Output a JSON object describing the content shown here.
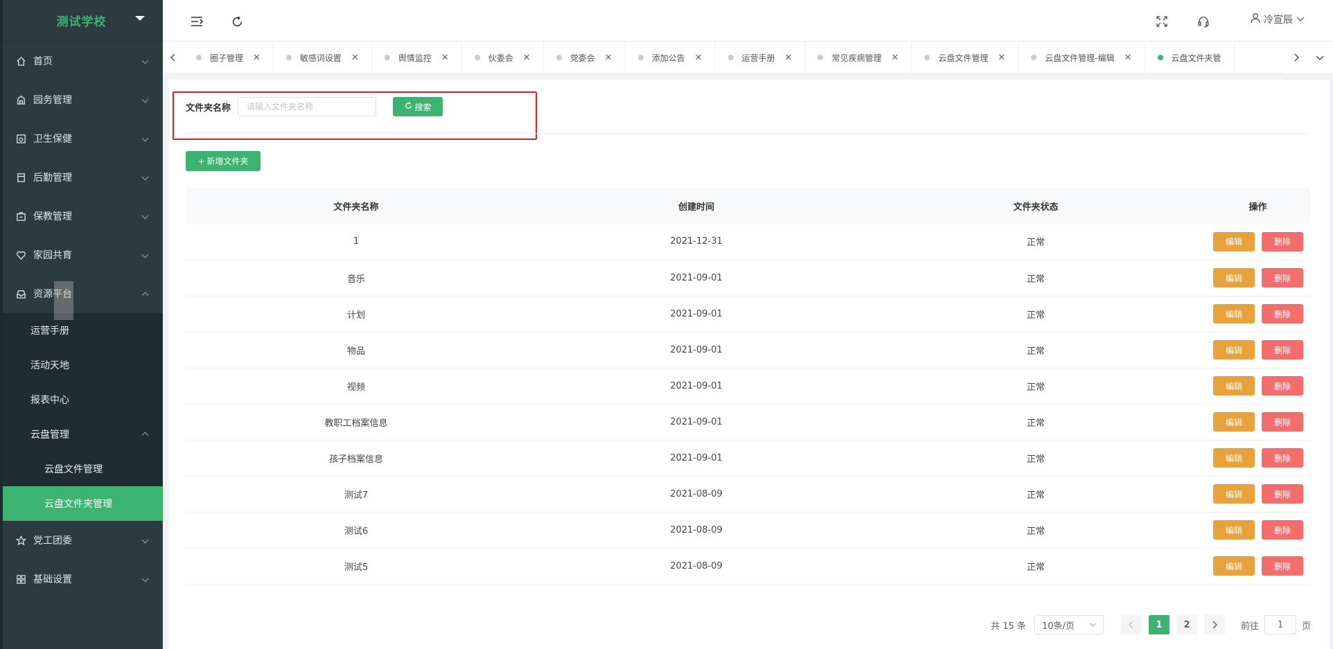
{
  "brand": {
    "title": "测试学校"
  },
  "sidebar": {
    "items": [
      {
        "label": "首页",
        "icon": "home-icon"
      },
      {
        "label": "园务管理",
        "icon": "building-icon"
      },
      {
        "label": "卫生保健",
        "icon": "health-icon"
      },
      {
        "label": "后勤管理",
        "icon": "logistics-icon"
      },
      {
        "label": "保教管理",
        "icon": "briefcase-icon"
      },
      {
        "label": "家园共育",
        "icon": "heart-icon"
      },
      {
        "label": "资源平台",
        "icon": "inbox-icon"
      }
    ],
    "resource_sub": [
      {
        "label": "运营手册"
      },
      {
        "label": "活动天地"
      },
      {
        "label": "报表中心"
      },
      {
        "label": "云盘管理"
      }
    ],
    "cloud_sub": [
      {
        "label": "云盘文件管理"
      },
      {
        "label": "云盘文件夹管理"
      }
    ],
    "bottom_items": [
      {
        "label": "党工团委",
        "icon": "star-icon"
      },
      {
        "label": "基础设置",
        "icon": "grid-icon"
      }
    ]
  },
  "header": {
    "username": "冷宣辰"
  },
  "tabs": [
    {
      "label": "圈子管理"
    },
    {
      "label": "敏感词设置"
    },
    {
      "label": "舆情监控"
    },
    {
      "label": "伙委会"
    },
    {
      "label": "党委会"
    },
    {
      "label": "添加公告"
    },
    {
      "label": "运营手册"
    },
    {
      "label": "常见疾病管理"
    },
    {
      "label": "云盘文件管理"
    },
    {
      "label": "云盘文件管理-编辑"
    },
    {
      "label": "云盘文件夹管"
    }
  ],
  "filter": {
    "label": "文件夹名称",
    "placeholder": "请输入文件夹名称",
    "search_label": "搜索"
  },
  "actions": {
    "add_label": "新增文件夹"
  },
  "table": {
    "headers": [
      "文件夹名称",
      "创建时间",
      "文件夹状态",
      "操作"
    ],
    "edit_label": "编辑",
    "delete_label": "删除",
    "rows": [
      {
        "name": "1",
        "time": "2021-12-31",
        "status": "正常"
      },
      {
        "name": "音乐",
        "time": "2021-09-01",
        "status": "正常"
      },
      {
        "name": "计划",
        "time": "2021-09-01",
        "status": "正常"
      },
      {
        "name": "物品",
        "time": "2021-09-01",
        "status": "正常"
      },
      {
        "name": "视频",
        "time": "2021-09-01",
        "status": "正常"
      },
      {
        "name": "教职工档案信息",
        "time": "2021-09-01",
        "status": "正常"
      },
      {
        "name": "孩子档案信息",
        "time": "2021-09-01",
        "status": "正常"
      },
      {
        "name": "测试7",
        "time": "2021-08-09",
        "status": "正常"
      },
      {
        "name": "测试6",
        "time": "2021-08-09",
        "status": "正常"
      },
      {
        "name": "测试5",
        "time": "2021-08-09",
        "status": "正常"
      }
    ]
  },
  "pagination": {
    "total_text": "共 15 条",
    "page_size": "10条/页",
    "pages": [
      "1",
      "2"
    ],
    "goto_prefix": "前往",
    "goto_value": "1",
    "goto_suffix": "页"
  },
  "colors": {
    "accent": "#3cb371",
    "sidebar_bg": "#2b3b40",
    "edit": "#e6a23c",
    "delete": "#f56c6c",
    "highlight_box": "#e0201e"
  }
}
